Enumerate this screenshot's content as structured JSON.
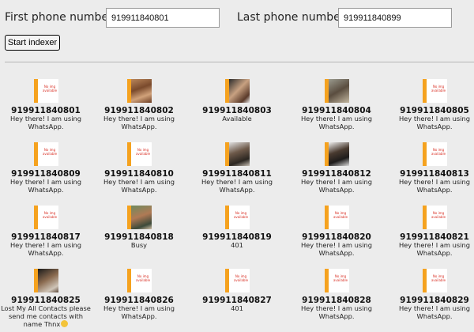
{
  "form": {
    "first_label": "First phone number",
    "first_value": "919911840801",
    "last_label": "Last phone number",
    "last_value": "919911840899",
    "start_button": "Start indexer"
  },
  "no_img_text": "No img available",
  "accent_color": "#f5a21f",
  "contacts": [
    {
      "number": "919911840801",
      "status": "Hey there! I am using WhatsApp.",
      "photo": false
    },
    {
      "number": "919911840802",
      "status": "Hey there! I am using WhatsApp.",
      "photo": true
    },
    {
      "number": "919911840803",
      "status": "Available",
      "photo": true
    },
    {
      "number": "919911840804",
      "status": "Hey there! I am using WhatsApp.",
      "photo": true
    },
    {
      "number": "919911840805",
      "status": "Hey there! I am using WhatsApp.",
      "photo": false
    },
    {
      "number": "919911840809",
      "status": "Hey there! I am using WhatsApp.",
      "photo": false
    },
    {
      "number": "919911840810",
      "status": "Hey there! I am using WhatsApp.",
      "photo": false
    },
    {
      "number": "919911840811",
      "status": "Hey there! I am using WhatsApp.",
      "photo": true
    },
    {
      "number": "919911840812",
      "status": "Hey there! I am using WhatsApp.",
      "photo": true
    },
    {
      "number": "919911840813",
      "status": "Hey there! I am using WhatsApp.",
      "photo": false
    },
    {
      "number": "919911840817",
      "status": "Hey there! I am using WhatsApp.",
      "photo": false
    },
    {
      "number": "919911840818",
      "status": "Busy",
      "photo": true
    },
    {
      "number": "919911840819",
      "status": "401",
      "photo": false
    },
    {
      "number": "919911840820",
      "status": "Hey there! I am using WhatsApp.",
      "photo": false
    },
    {
      "number": "919911840821",
      "status": "Hey there! I am using WhatsApp.",
      "photo": false
    },
    {
      "number": "919911840825",
      "status": "Lost My All Contacts please send me contacts with name Thnx",
      "status_emoji": "smiley-emoji",
      "photo": true
    },
    {
      "number": "919911840826",
      "status": "Hey there! I am using WhatsApp.",
      "photo": false
    },
    {
      "number": "919911840827",
      "status": "401",
      "photo": false
    },
    {
      "number": "919911840828",
      "status": "Hey there! I am using WhatsApp.",
      "photo": false
    },
    {
      "number": "919911840829",
      "status": "Hey there! I am using WhatsApp.",
      "photo": false
    }
  ]
}
